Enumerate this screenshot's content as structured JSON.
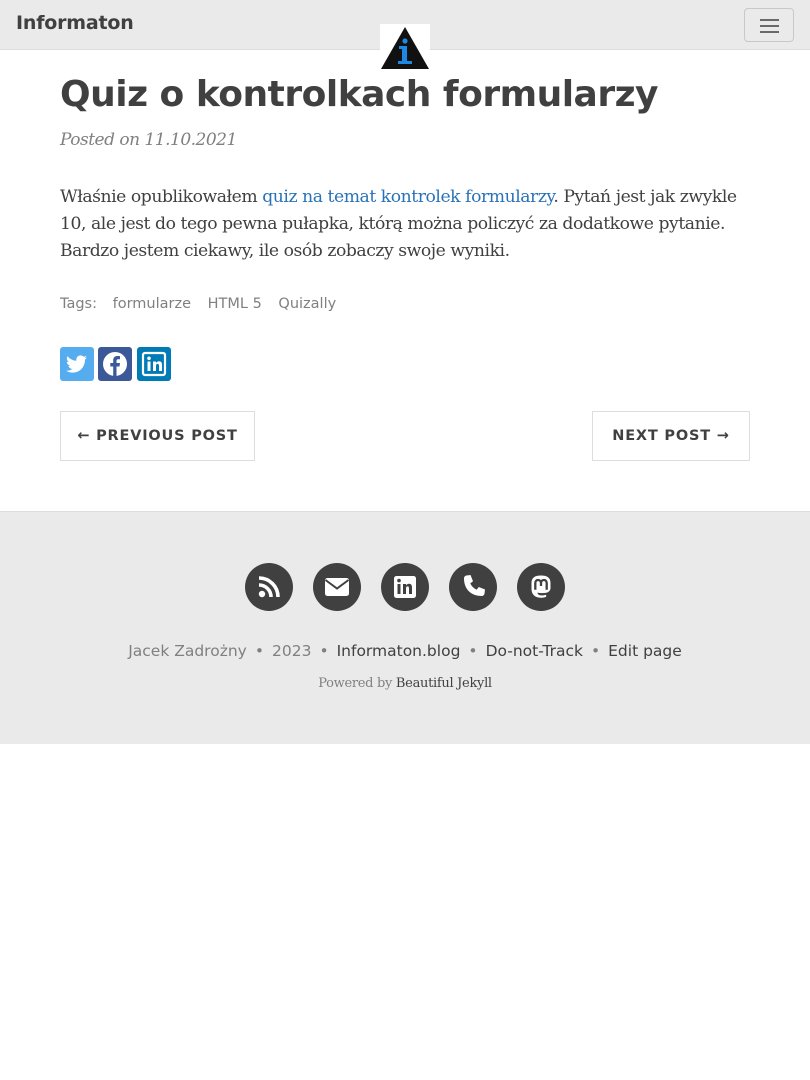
{
  "navbar": {
    "brand": "Informaton",
    "logo_icon": "info-triangle-logo",
    "menu_icon": "hamburger-icon"
  },
  "post": {
    "title": "Quiz o kontrolkach formularzy",
    "meta": "Posted on 11.10.2021",
    "body_before": "Właśnie opublikowałem ",
    "body_link": "quiz na temat kontrolek formularzy",
    "body_after": ". Pytań jest jak zwykle 10, ale jest do tego pewna pułapka, którą można policzyć za dodatkowe pytanie. Bardzo jestem ciekawy, ile osób zobaczy swoje wyniki."
  },
  "tags": {
    "label": "Tags:",
    "items": [
      "formularze",
      "HTML 5",
      "Quizally"
    ]
  },
  "share": {
    "icons": [
      "twitter-icon",
      "facebook-icon",
      "linkedin-icon"
    ],
    "colors": {
      "twitter": "#55acee",
      "facebook": "#3b5998",
      "linkedin": "#007bb5"
    }
  },
  "pager": {
    "previous": "← PREVIOUS POST",
    "next": "NEXT POST →"
  },
  "footer": {
    "social_icons": [
      "rss-icon",
      "email-icon",
      "linkedin-icon",
      "phone-icon",
      "mastodon-icon"
    ],
    "author": "Jacek Zadrożny",
    "year": "2023",
    "site": "Informaton.blog",
    "dnt": "Do-not-Track",
    "edit": "Edit page",
    "powered_prefix": "Powered by ",
    "powered_link": "Beautiful Jekyll",
    "separator": "•"
  },
  "colors": {
    "link": "#2a72b8",
    "text": "#404040",
    "muted": "#808080",
    "navbar_bg": "#eaeaea",
    "logo_blue": "#1e88e5"
  }
}
